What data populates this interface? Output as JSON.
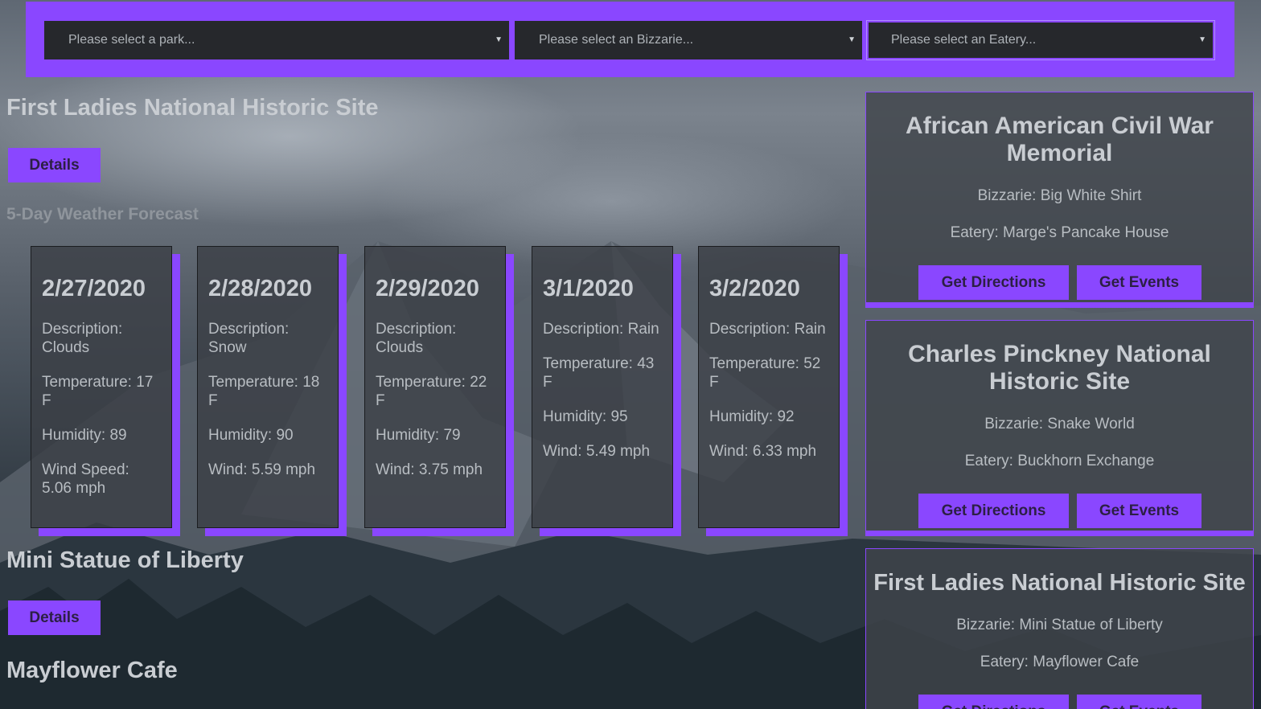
{
  "selectors": {
    "park_placeholder": "Please select a park...",
    "bizzarie_placeholder": "Please select an Bizzarie...",
    "eatery_placeholder": "Please select an Eatery...",
    "caret": "▼"
  },
  "left": {
    "park_title": "First Ladies National Historic Site",
    "details_label": "Details",
    "forecast_heading": "5-Day Weather Forecast",
    "bizzarie_title": "Mini Statue of Liberty",
    "eatery_title": "Mayflower Cafe"
  },
  "forecast": [
    {
      "date": "2/27/2020",
      "description": "Description: Clouds",
      "temperature": "Temperature: 17 F",
      "humidity": "Humidity: 89",
      "wind": "Wind Speed: 5.06 mph"
    },
    {
      "date": "2/28/2020",
      "description": "Description: Snow",
      "temperature": "Temperature: 18 F",
      "humidity": "Humidity: 90",
      "wind": "Wind: 5.59 mph"
    },
    {
      "date": "2/29/2020",
      "description": "Description: Clouds",
      "temperature": "Temperature: 22 F",
      "humidity": "Humidity: 79",
      "wind": "Wind: 3.75 mph"
    },
    {
      "date": "3/1/2020",
      "description": "Description: Rain",
      "temperature": "Temperature: 43 F",
      "humidity": "Humidity: 95",
      "wind": "Wind: 5.49 mph"
    },
    {
      "date": "3/2/2020",
      "description": "Description: Rain",
      "temperature": "Temperature: 52 F",
      "humidity": "Humidity: 92",
      "wind": "Wind: 6.33 mph"
    }
  ],
  "saved": [
    {
      "title": "African American Civil War Memorial",
      "bizzarie": "Bizzarie: Big White Shirt",
      "eatery": "Eatery: Marge's Pancake House",
      "directions_label": "Get Directions",
      "events_label": "Get Events"
    },
    {
      "title": "Charles Pinckney National Historic Site",
      "bizzarie": "Bizzarie: Snake World",
      "eatery": "Eatery: Buckhorn Exchange",
      "directions_label": "Get Directions",
      "events_label": "Get Events"
    },
    {
      "title": "First Ladies National Historic Site",
      "bizzarie": "Bizzarie: Mini Statue of Liberty",
      "eatery": "Eatery: Mayflower Cafe",
      "directions_label": "Get Directions",
      "events_label": "Get Events"
    }
  ],
  "colors": {
    "accent": "#8a47ff",
    "select_bg": "#26282c",
    "text_light": "#c9cdd2"
  }
}
